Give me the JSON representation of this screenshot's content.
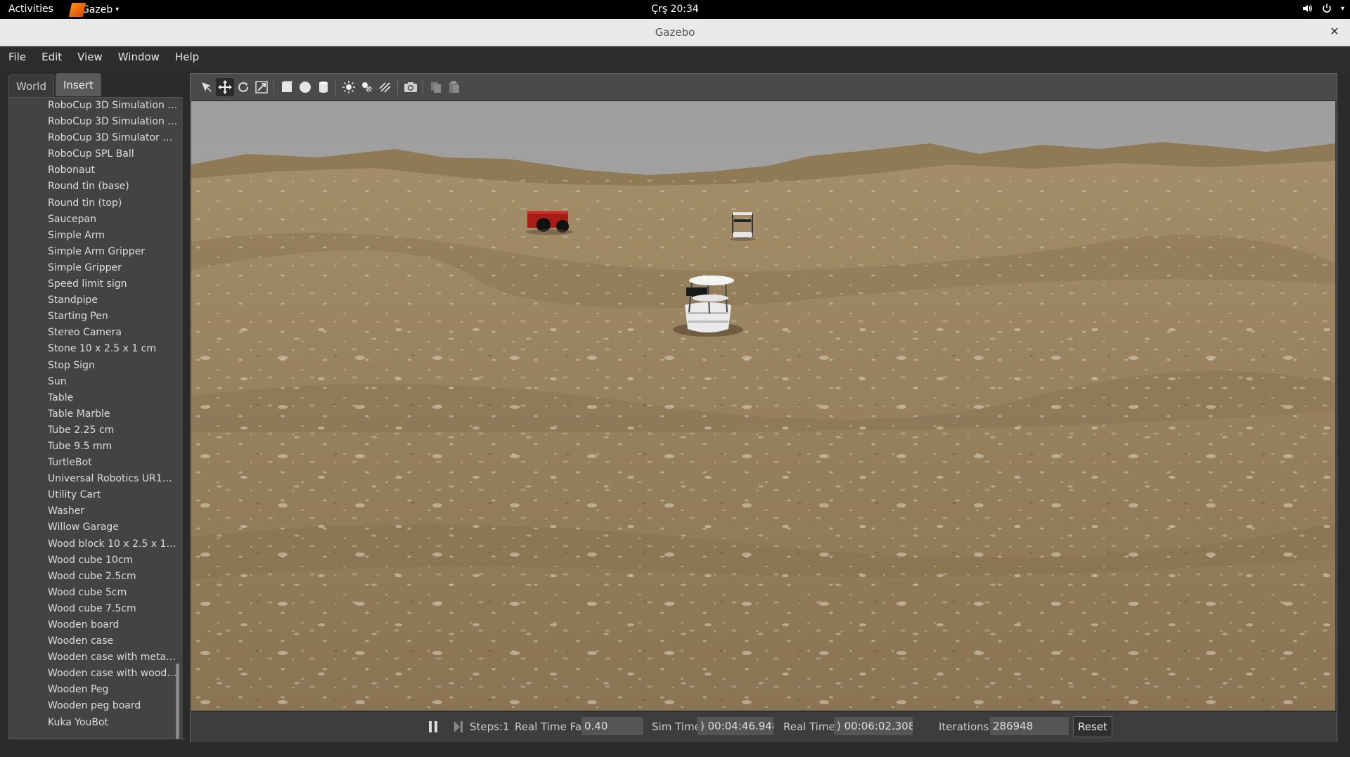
{
  "topbar": {
    "activities": "Activities",
    "app_name": "Gazeb",
    "clock": "Çrş 20:34"
  },
  "window": {
    "title": "Gazebo"
  },
  "menu": [
    "File",
    "Edit",
    "View",
    "Window",
    "Help"
  ],
  "panel": {
    "tabs": [
      "World",
      "Insert"
    ],
    "active_tab": "Insert",
    "items": [
      "RoboCup 3D Simulation B...",
      "RoboCup 3D Simulation F...",
      "RoboCup 3D Simulator G...",
      "RoboCup SPL Ball",
      "Robonaut",
      "Round tin (base)",
      "Round tin (top)",
      "Saucepan",
      "Simple Arm",
      "Simple Arm Gripper",
      "Simple Gripper",
      "Speed limit sign",
      "Standpipe",
      "Starting Pen",
      "Stereo Camera",
      "Stone 10 x 2.5 x 1 cm",
      "Stop Sign",
      "Sun",
      "Table",
      "Table Marble",
      "Tube 2.25 cm",
      "Tube 9.5 mm",
      "TurtleBot",
      "Universal Robotics UR10 ...",
      "Utility Cart",
      "Washer",
      "Willow Garage",
      "Wood block 10 x 2.5 x 1 ...",
      "Wood cube 10cm",
      "Wood cube 2.5cm",
      "Wood cube 5cm",
      "Wood cube 7.5cm",
      "Wooden board",
      "Wooden case",
      "Wooden case with metal ...",
      "Wooden case with woode...",
      "Wooden Peg",
      "Wooden peg board",
      "Kuka YouBot"
    ]
  },
  "toolbar": {
    "tools": [
      "select-arrow-icon",
      "translate-icon",
      "rotate-icon",
      "scale-icon",
      "box-icon",
      "sphere-icon",
      "cylinder-icon",
      "point-light-icon",
      "spot-light-icon",
      "directional-light-icon",
      "screenshot-icon",
      "copy-icon",
      "paste-icon"
    ],
    "selected_tool": "translate-icon"
  },
  "statusbar": {
    "steps_label": "Steps:",
    "steps_value": "1",
    "rtf_label": "Real Time Factor:",
    "rtf_value": "0.40",
    "sim_time_label": "Sim Time:",
    "sim_time_value": ") 00:04:46.948",
    "real_time_label": "Real Time:",
    "real_time_value": ") 00:06:02.308",
    "iterations_label": "Iterations:",
    "iterations_value": "286948",
    "reset_label": "Reset"
  },
  "colors": {
    "sky": "#a8a8a8",
    "terrain": "#9a8460",
    "accent": "#ff8c1a"
  }
}
